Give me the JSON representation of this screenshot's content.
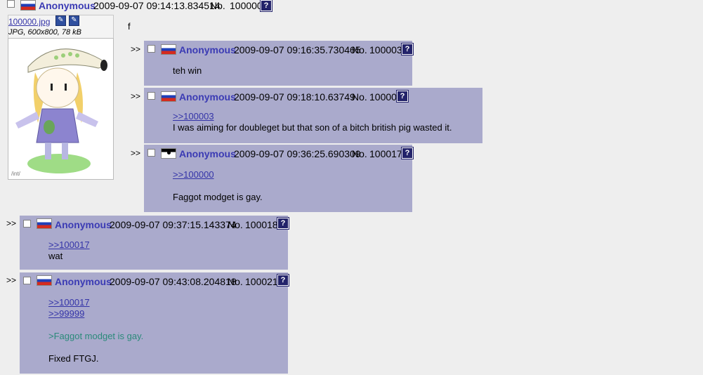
{
  "op": {
    "name": "Anonymous",
    "datetime": "2009-09-07 09:14:13.834514",
    "no_label": "No.",
    "no": "100000",
    "help": "?",
    "file_name": "100000.jpg",
    "file_info": "JPG, 600x800, 78 kB",
    "body": "f",
    "watermark": "/int/"
  },
  "replies": [
    {
      "arrow": ">>",
      "name": "Anonymous",
      "datetime": "2009-09-07 09:16:35.730465",
      "no_label": "No.",
      "no": "100003",
      "help": "?",
      "flag": "ru",
      "lines": [
        "teh win"
      ]
    },
    {
      "arrow": ">>",
      "name": "Anonymous",
      "datetime": "2009-09-07 09:18:10.63749",
      "no_label": "No.",
      "no": "100005",
      "help": "?",
      "flag": "ru",
      "link1": ">>100003",
      "lines": [
        "I was aiming for doubleget but that son of a bitch british pig wasted it."
      ]
    },
    {
      "arrow": ">>",
      "name": "Anonymous",
      "datetime": "2009-09-07 09:36:25.690309",
      "no_label": "No.",
      "no": "100017",
      "help": "?",
      "flag": "de-empire",
      "link1": ">>100000",
      "lines": [
        "Faggot modget is gay."
      ]
    },
    {
      "arrow": ">>",
      "name": "Anonymous",
      "datetime": "2009-09-07 09:37:15.143374",
      "no_label": "No.",
      "no": "100018",
      "help": "?",
      "flag": "ru",
      "link1": ">>100017",
      "lines": [
        "wat"
      ]
    },
    {
      "arrow": ">>",
      "name": "Anonymous",
      "datetime": "2009-09-07 09:43:08.204818",
      "no_label": "No.",
      "no": "100021",
      "help": "?",
      "flag": "ru",
      "link1": ">>100017",
      "link2": ">>99999",
      "quote": ">Faggot modget is gay.",
      "lines": [
        "Fixed FTGJ."
      ]
    }
  ],
  "colors": {
    "reply_bg": "#aaaacc",
    "name": "#3b3bb4",
    "link": "#3434a8",
    "quote": "#2b8a7a",
    "page_bg": "#eeeeee"
  },
  "icons": [
    "checkbox-icon",
    "russia-flag-icon",
    "german-empire-flag-icon",
    "help-icon",
    "edit-icon"
  ]
}
